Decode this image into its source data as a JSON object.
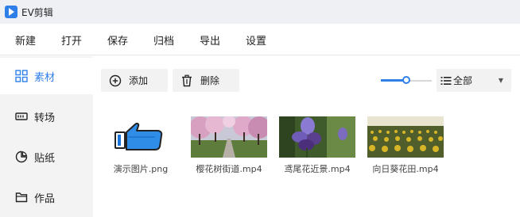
{
  "app": {
    "title": "EV剪辑"
  },
  "menu": [
    "新建",
    "打开",
    "保存",
    "归档",
    "导出",
    "设置"
  ],
  "sidebar": {
    "items": [
      {
        "label": "素材",
        "icon": "grid-icon",
        "active": true
      },
      {
        "label": "转场",
        "icon": "transition-icon",
        "active": false
      },
      {
        "label": "贴纸",
        "icon": "sticker-icon",
        "active": false
      },
      {
        "label": "作品",
        "icon": "folder-icon",
        "active": false
      }
    ]
  },
  "toolbar": {
    "add_label": "添加",
    "delete_label": "删除",
    "zoom_level": 0.5,
    "filter": {
      "selected": "全部"
    }
  },
  "media": [
    {
      "name": "演示图片.png",
      "kind": "image"
    },
    {
      "name": "樱花树街道.mp4",
      "kind": "video"
    },
    {
      "name": "鸢尾花近景.mp4",
      "kind": "video"
    },
    {
      "name": "向日葵花田.mp4",
      "kind": "video"
    }
  ],
  "colors": {
    "accent": "#2f7fe8",
    "sidebar_bg": "#f3f3f3",
    "titlebar_bg": "#eef0f4"
  }
}
